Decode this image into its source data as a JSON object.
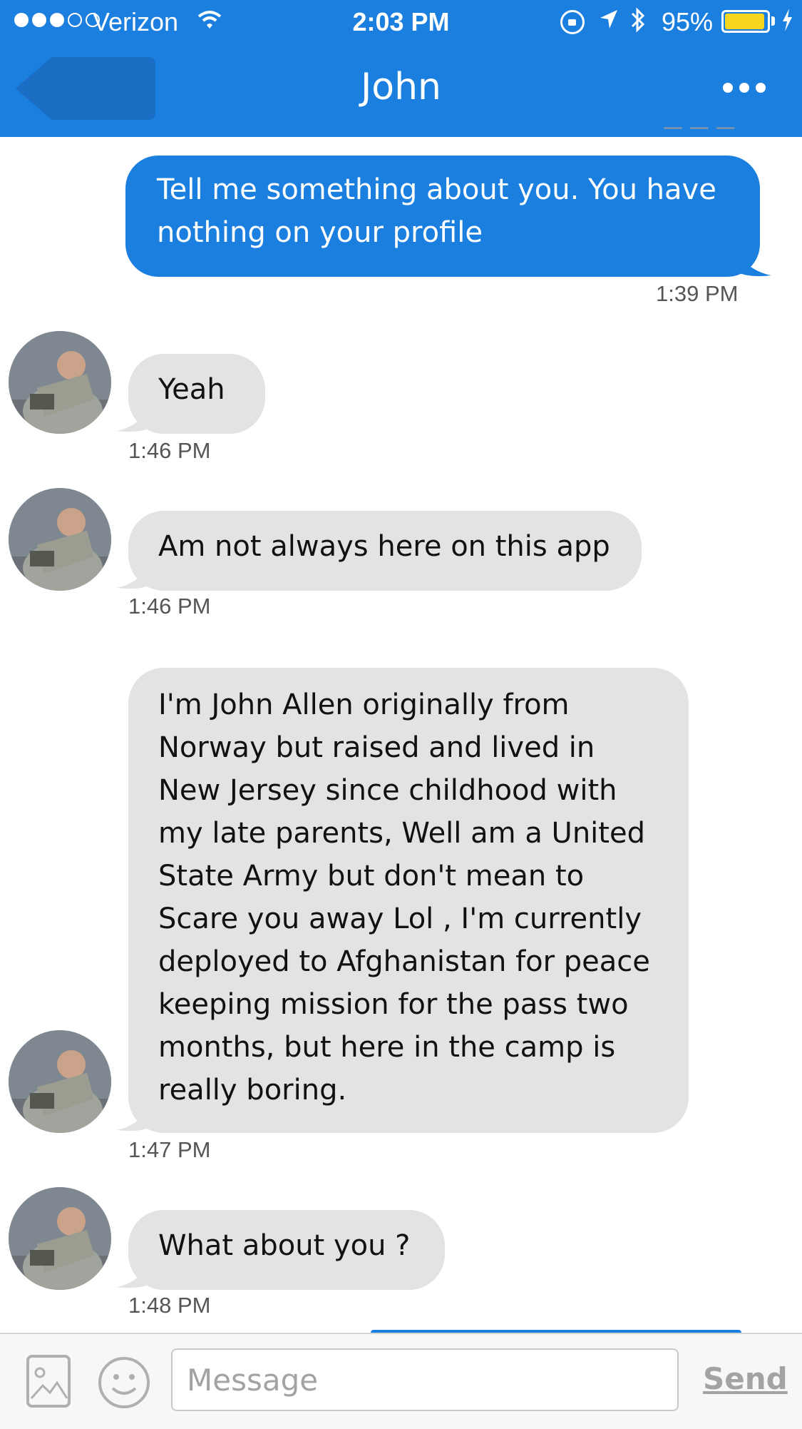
{
  "status_bar": {
    "carrier": "Verizon",
    "time": "2:03 PM",
    "battery_percent": "95%",
    "battery_level": 0.95,
    "battery_color": "#f8d51e"
  },
  "header": {
    "title": "John",
    "accent_color": "#1b7fe0"
  },
  "messages": [
    {
      "direction": "outgoing",
      "text_lines": [
        "Tell me something about you. You have",
        "nothing on your profile"
      ],
      "time": "1:39 PM"
    },
    {
      "direction": "incoming",
      "text_lines": [
        "Yeah"
      ],
      "time": "1:46 PM"
    },
    {
      "direction": "incoming",
      "text_lines": [
        "Am not always here on this app"
      ],
      "time": "1:46 PM"
    },
    {
      "direction": "incoming",
      "text_lines": [
        "I'm John Allen originally from",
        "Norway but raised and lived in",
        "New Jersey since childhood with",
        "my late parents, Well am a United",
        "State Army but don't mean to",
        "Scare you away Lol , I'm currently",
        "deployed to Afghanistan for peace",
        "keeping mission for the  pass two",
        "months, but here in the camp is",
        "really boring."
      ],
      "time": "1:47 PM"
    },
    {
      "direction": "incoming",
      "text_lines": [
        "What about you ?"
      ],
      "time": "1:48 PM"
    }
  ],
  "composer": {
    "placeholder": "Message",
    "send_label": "Send"
  },
  "icons": {
    "back": "back-arrow-icon",
    "more": "more-dots-icon",
    "image": "image-icon",
    "emoji": "emoji-icon"
  }
}
